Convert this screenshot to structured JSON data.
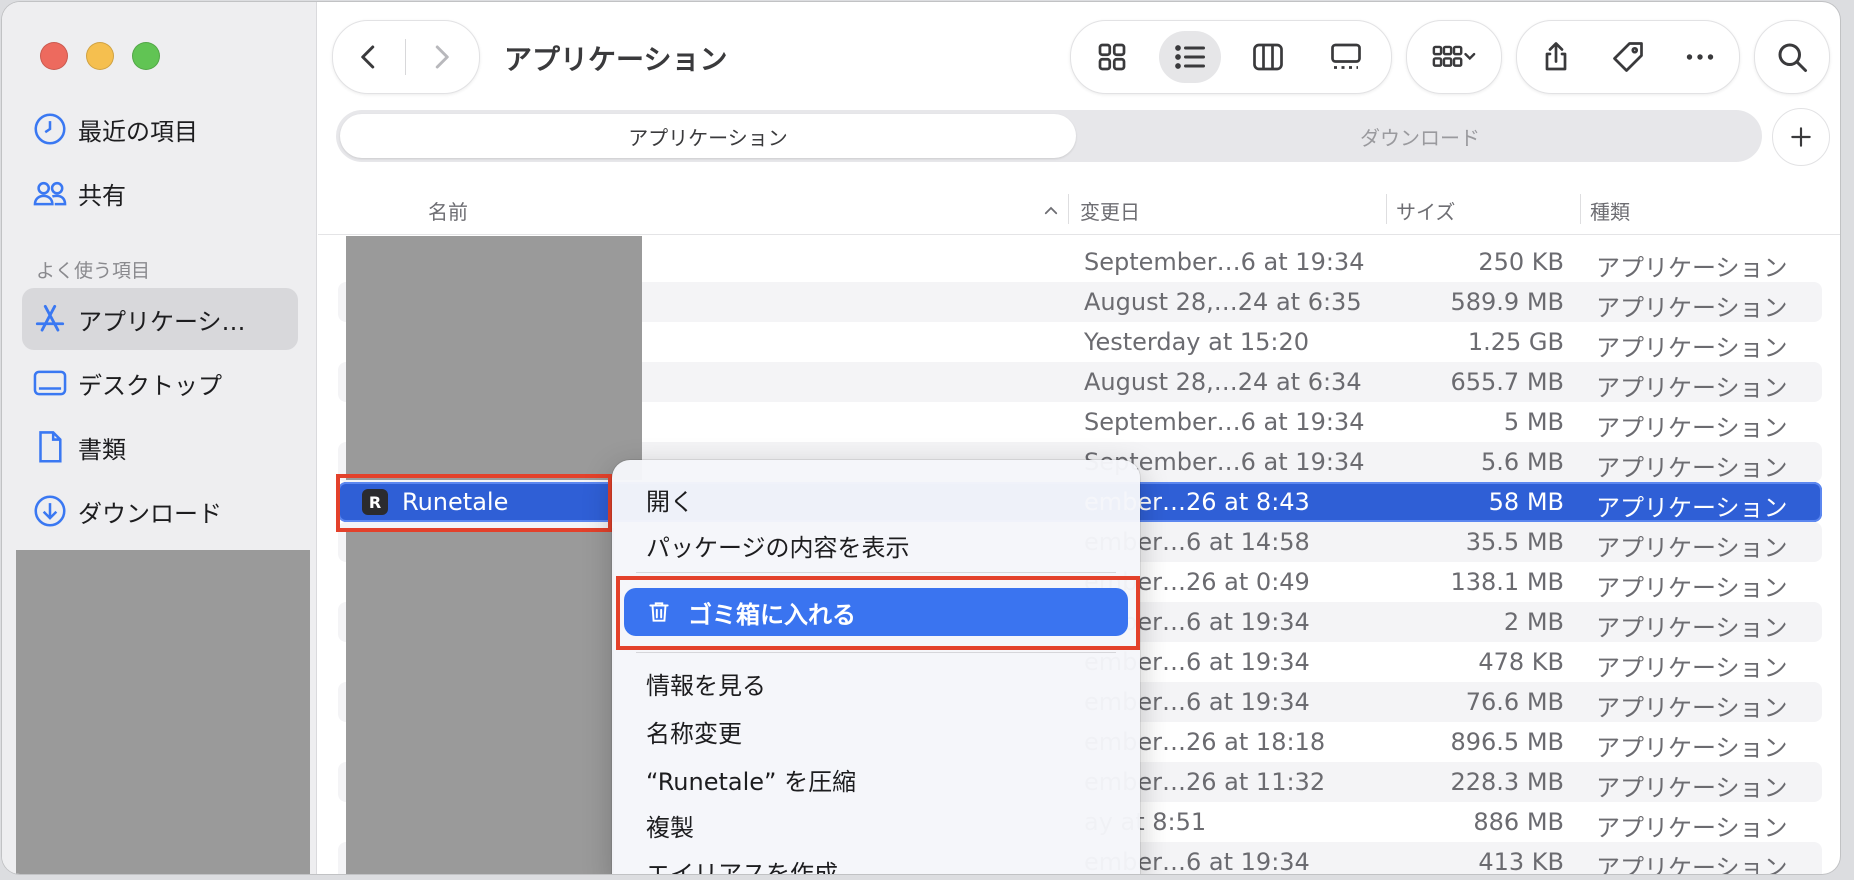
{
  "window": {
    "title": "アプリケーション"
  },
  "sidebar": {
    "recents": "最近の項目",
    "shared": "共有",
    "section_favorites": "よく使う項目",
    "items": [
      {
        "label": "アプリケーシ…",
        "icon": "applications-icon",
        "selected": true
      },
      {
        "label": "デスクトップ",
        "icon": "desktop-icon"
      },
      {
        "label": "書類",
        "icon": "document-icon"
      },
      {
        "label": "ダウンロード",
        "icon": "download-icon"
      }
    ]
  },
  "tabs": [
    {
      "label": "アプリケーション",
      "active": true
    },
    {
      "label": "ダウンロード",
      "active": false
    }
  ],
  "columns": {
    "name": "名前",
    "date": "変更日",
    "size": "サイズ",
    "kind": "種類"
  },
  "rows": [
    {
      "date": "September…6 at 19:34",
      "size": "250 KB",
      "kind": "アプリケーション"
    },
    {
      "date": "August 28,…24 at 6:35",
      "size": "589.9 MB",
      "kind": "アプリケーション"
    },
    {
      "date": "Yesterday at 15:20",
      "size": "1.25 GB",
      "kind": "アプリケーション"
    },
    {
      "date": "August 28,…24 at 6:34",
      "size": "655.7 MB",
      "kind": "アプリケーション"
    },
    {
      "date": "September…6 at 19:34",
      "size": "5 MB",
      "kind": "アプリケーション"
    },
    {
      "date": "September…6 at 19:34",
      "size": "5.6 MB",
      "kind": "アプリケーション"
    },
    {
      "name": "Runetale",
      "date": "ember…26 at 8:43",
      "size": "58 MB",
      "kind": "アプリケーション",
      "selected": true
    },
    {
      "date": "ember…6 at 14:58",
      "size": "35.5 MB",
      "kind": "アプリケーション"
    },
    {
      "date": "ember…26 at 0:49",
      "size": "138.1 MB",
      "kind": "アプリケーション"
    },
    {
      "date": "ember…6 at 19:34",
      "size": "2 MB",
      "kind": "アプリケーション"
    },
    {
      "date": "ember…6 at 19:34",
      "size": "478 KB",
      "kind": "アプリケーション"
    },
    {
      "date": "ember…6 at 19:34",
      "size": "76.6 MB",
      "kind": "アプリケーション"
    },
    {
      "date": "ember…26 at 18:18",
      "size": "896.5 MB",
      "kind": "アプリケーション"
    },
    {
      "date": "ember…26 at 11:32",
      "size": "228.3 MB",
      "kind": "アプリケーション"
    },
    {
      "date": "ay at 8:51",
      "size": "886 MB",
      "kind": "アプリケーション"
    },
    {
      "date": "ember…6 at 19:34",
      "size": "413 KB",
      "kind": "アプリケーション"
    }
  ],
  "context_menu": {
    "open": "開く",
    "show_package": "パッケージの内容を表示",
    "move_to_trash": "ゴミ箱に入れる",
    "get_info": "情報を見る",
    "rename": "名称変更",
    "compress": "“Runetale” を圧縮",
    "duplicate": "複製",
    "make_alias": "エイリアスを作成"
  },
  "colors": {
    "selection": "#2f5fd6",
    "highlight_box": "#e3412b",
    "menu_active": "#3a74f0"
  }
}
